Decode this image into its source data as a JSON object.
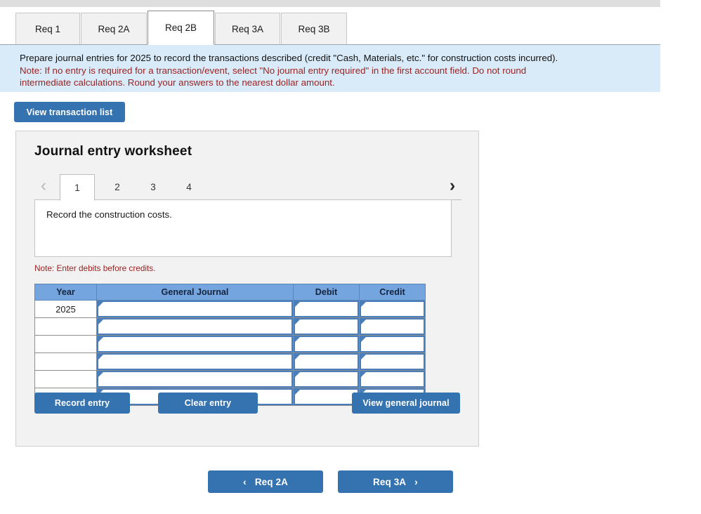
{
  "tabs": [
    {
      "label": "Req 1",
      "active": false
    },
    {
      "label": "Req 2A",
      "active": false
    },
    {
      "label": "Req 2B",
      "active": true
    },
    {
      "label": "Req 3A",
      "active": false
    },
    {
      "label": "Req 3B",
      "active": false
    }
  ],
  "instructions": {
    "line1": "Prepare journal entries for 2025 to record the transactions described (credit \"Cash, Materials, etc.\" for construction costs incurred).",
    "note1": "Note: If no entry is required for a transaction/event, select \"No journal entry required\" in the first account field. Do not round",
    "note2": "intermediate calculations. Round your answers to the nearest dollar amount."
  },
  "toolbar": {
    "view_transaction_list": "View transaction list"
  },
  "worksheet": {
    "title": "Journal entry worksheet",
    "pager": {
      "prev_icon": "‹",
      "next_icon": "›",
      "pages": [
        {
          "label": "1",
          "active": true
        },
        {
          "label": "2",
          "active": false
        },
        {
          "label": "3",
          "active": false
        },
        {
          "label": "4",
          "active": false
        }
      ]
    },
    "record_description": "Record the construction costs.",
    "debit_note": "Note: Enter debits before credits.",
    "table": {
      "headers": [
        "Year",
        "General Journal",
        "Debit",
        "Credit"
      ],
      "rows": [
        {
          "year": "2025",
          "general_journal": "",
          "debit": "",
          "credit": ""
        },
        {
          "year": "",
          "general_journal": "",
          "debit": "",
          "credit": ""
        },
        {
          "year": "",
          "general_journal": "",
          "debit": "",
          "credit": ""
        },
        {
          "year": "",
          "general_journal": "",
          "debit": "",
          "credit": ""
        },
        {
          "year": "",
          "general_journal": "",
          "debit": "",
          "credit": ""
        },
        {
          "year": "",
          "general_journal": "",
          "debit": "",
          "credit": ""
        }
      ]
    },
    "actions": {
      "record_entry": "Record entry",
      "clear_entry": "Clear entry",
      "view_general_journal": "View general journal"
    }
  },
  "bottom_nav": {
    "prev_label": "Req 2A",
    "prev_icon": "‹",
    "next_label": "Req 3A",
    "next_icon": "›"
  },
  "colors": {
    "accent_blue": "#3572b0",
    "header_blue": "#74a5df",
    "banner_blue": "#d9ebf8",
    "note_red": "#9b2222",
    "cell_border_blue": "#4a7ebb"
  }
}
